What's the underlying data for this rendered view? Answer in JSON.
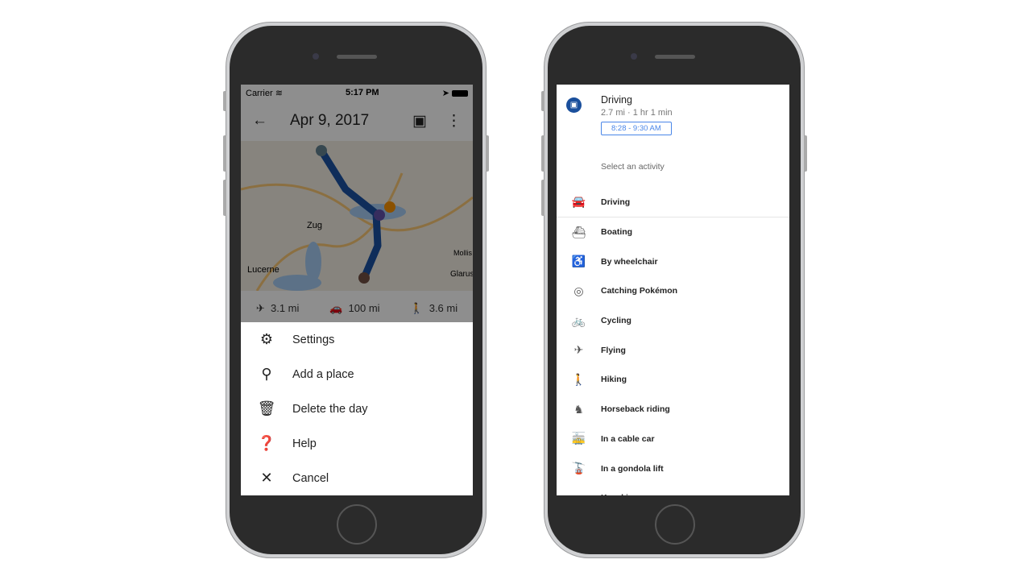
{
  "left_phone": {
    "status": {
      "carrier": "Carrier",
      "time": "5:17 PM"
    },
    "appbar": {
      "title": "Apr 9, 2017"
    },
    "map": {
      "labels": [
        "Zug",
        "Lucerne",
        "Mollis",
        "Glarus"
      ],
      "route_color": "#1a4f9c"
    },
    "stats": [
      {
        "icon": "flight-icon",
        "value": "3.1 mi"
      },
      {
        "icon": "car-icon",
        "value": "100 mi"
      },
      {
        "icon": "walk-icon",
        "value": "3.6 mi"
      }
    ],
    "menu": [
      {
        "icon": "gear-icon",
        "label": "Settings"
      },
      {
        "icon": "add-place-icon",
        "label": "Add a place"
      },
      {
        "icon": "trash-icon",
        "label": "Delete the day"
      },
      {
        "icon": "help-icon",
        "label": "Help"
      },
      {
        "icon": "close-icon",
        "label": "Cancel"
      }
    ]
  },
  "right_phone": {
    "header": {
      "activity": "Driving",
      "details": "2.7 mi · 1 hr 1 min",
      "time_range": "8:28 - 9:30 AM"
    },
    "select_label": "Select an activity",
    "activities": [
      {
        "icon": "car-icon",
        "label": "Driving"
      },
      {
        "icon": "boat-icon",
        "label": "Boating"
      },
      {
        "icon": "wheelchair-icon",
        "label": "By wheelchair"
      },
      {
        "icon": "pokeball-icon",
        "label": "Catching Pokémon"
      },
      {
        "icon": "bike-icon",
        "label": "Cycling"
      },
      {
        "icon": "plane-icon",
        "label": "Flying"
      },
      {
        "icon": "hiking-icon",
        "label": "Hiking"
      },
      {
        "icon": "horse-icon",
        "label": "Horseback riding"
      },
      {
        "icon": "cable-car-icon",
        "label": "In a cable car"
      },
      {
        "icon": "gondola-icon",
        "label": "In a gondola lift"
      },
      {
        "icon": "kayak-icon",
        "label": "Kayaking"
      }
    ]
  }
}
